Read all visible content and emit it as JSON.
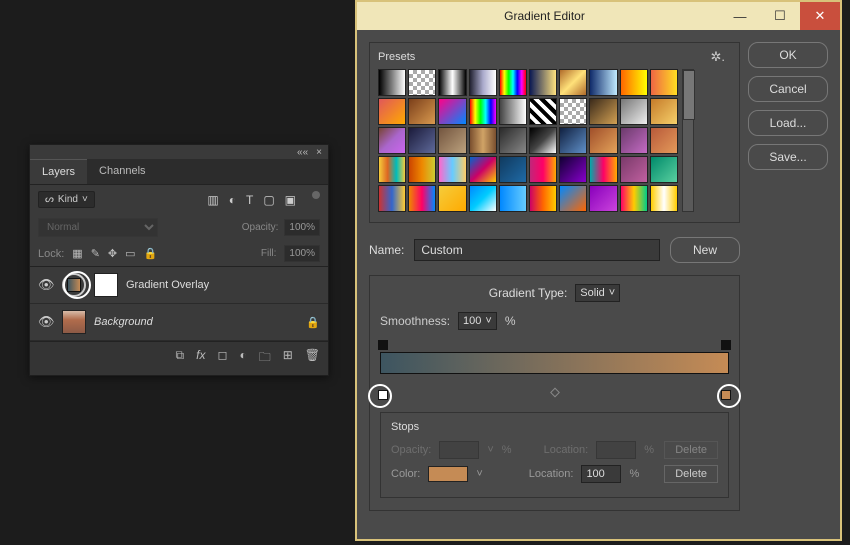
{
  "layers_panel": {
    "tabs": [
      {
        "label": "Layers",
        "active": true
      },
      {
        "label": "Channels",
        "active": false
      }
    ],
    "filter_label": "Kind",
    "blend_mode": "Normal",
    "opacity_label": "Opacity:",
    "opacity_value": "100%",
    "lock_label": "Lock:",
    "fill_label": "Fill:",
    "fill_value": "100%",
    "layers": [
      {
        "name": "Gradient Overlay",
        "italic": false,
        "has_gradient_effect": true,
        "locked": false
      },
      {
        "name": "Background",
        "italic": true,
        "has_gradient_effect": false,
        "locked": true
      }
    ]
  },
  "gradient_editor": {
    "window_title": "Gradient Editor",
    "buttons": {
      "ok": "OK",
      "cancel": "Cancel",
      "load": "Load...",
      "save": "Save...",
      "new": "New"
    },
    "presets_label": "Presets",
    "name_label": "Name:",
    "name_value": "Custom",
    "gradient_type_label": "Gradient Type:",
    "gradient_type_value": "Solid",
    "smoothness_label": "Smoothness:",
    "smoothness_value": "100",
    "smoothness_unit": "%",
    "stops_label": "Stops",
    "opacity_label": "Opacity:",
    "opacity_unit": "%",
    "location_label": "Location:",
    "location_unit": "%",
    "delete_label": "Delete",
    "color_label": "Color:",
    "selected_stop_color": "#c58b55",
    "selected_stop_location": "100",
    "gradient_colors": [
      "#3d5560",
      "#c58b55"
    ],
    "preset_swatches": [
      "linear-gradient(90deg,#000,#fff)",
      "repeating-conic-gradient(#aaa 0 25%,#fff 0 50%) 0 0/8px 8px",
      "linear-gradient(90deg,#000,#fff,#000)",
      "linear-gradient(90deg,#223,#aac,#fff)",
      "linear-gradient(90deg,#f00,#ff0,#0f0,#0ff,#00f,#f0f,#f00)",
      "linear-gradient(90deg,#0d1b54,#ffe27f)",
      "linear-gradient(135deg,#b06b2a,#ffe17a,#b06b2a)",
      "linear-gradient(90deg,#102b6a,#c0eaff)",
      "linear-gradient(90deg,#f60,#ff0)",
      "linear-gradient(90deg,#e64,#fd2)",
      "linear-gradient(135deg,#e0575a,#fa0)",
      "linear-gradient(135deg,#7b3f1a,#d99a4f)",
      "linear-gradient(135deg,#f08,#08f)",
      "linear-gradient(90deg,#f00,#ff0,#0f0,#0ff,#00f,#f0f)",
      "linear-gradient(90deg,#444,#fff)",
      "repeating-linear-gradient(45deg,#000 0 4px,#fff 4px 8px)",
      "repeating-conic-gradient(#aaa 0 25%,#fff 0 50%) 0 0/8px 8px",
      "linear-gradient(135deg,#3a2a1a,#d2a053)",
      "linear-gradient(135deg,#777,#eee)",
      "linear-gradient(135deg,#c57b2a,#f6d06a)",
      "linear-gradient(135deg,#743,#a6c,#c6e)",
      "linear-gradient(135deg,#1b1b3b,#5f6a9a)",
      "linear-gradient(135deg,#73553f,#bca27e)",
      "linear-gradient(90deg,#7a4f2f,#d0a366,#7a4f2f)",
      "linear-gradient(135deg,#2a2a2a,#888)",
      "linear-gradient(135deg,#000,#444,#fff)",
      "linear-gradient(135deg,#102040,#6090c8)",
      "linear-gradient(135deg,#a04f2a,#e4a35a)",
      "linear-gradient(135deg,#6b3a6b,#c46bc4)",
      "linear-gradient(135deg,#b85a3a,#e49a5a)",
      "linear-gradient(90deg,#f5cc3b,#d62,#0bb,#f5cc3b)",
      "linear-gradient(90deg,#c40,#e80,#cc3)",
      "linear-gradient(90deg,#f6c,#6cf,#fc6)",
      "linear-gradient(135deg,#06c,#c06,#fc0)",
      "linear-gradient(135deg,#103a5f,#1f6aa6)",
      "linear-gradient(90deg,#c0267a,#f06,#fa0)",
      "linear-gradient(135deg,#103,#80c)",
      "linear-gradient(90deg,#0aa,#f06,#fa0)",
      "linear-gradient(135deg,#7a3a6a,#c060a0)",
      "linear-gradient(135deg,#008a6a,#5ad0a0)",
      "linear-gradient(90deg,#c33,#36c,#fc3)",
      "linear-gradient(90deg,#e80,#f06,#08f)",
      "linear-gradient(135deg,#f5cc3b,#fa0)",
      "linear-gradient(135deg,#08f,#0cf,#fff)",
      "linear-gradient(90deg,#08f,#6cf)",
      "linear-gradient(90deg,#c06,#f60,#fc0)",
      "linear-gradient(135deg,#08f,#f60)",
      "linear-gradient(135deg,#80b,#c4d)",
      "linear-gradient(90deg,#f06,#fc0,#0c8)",
      "linear-gradient(90deg,#fc0,#fff,#fc0)"
    ]
  }
}
